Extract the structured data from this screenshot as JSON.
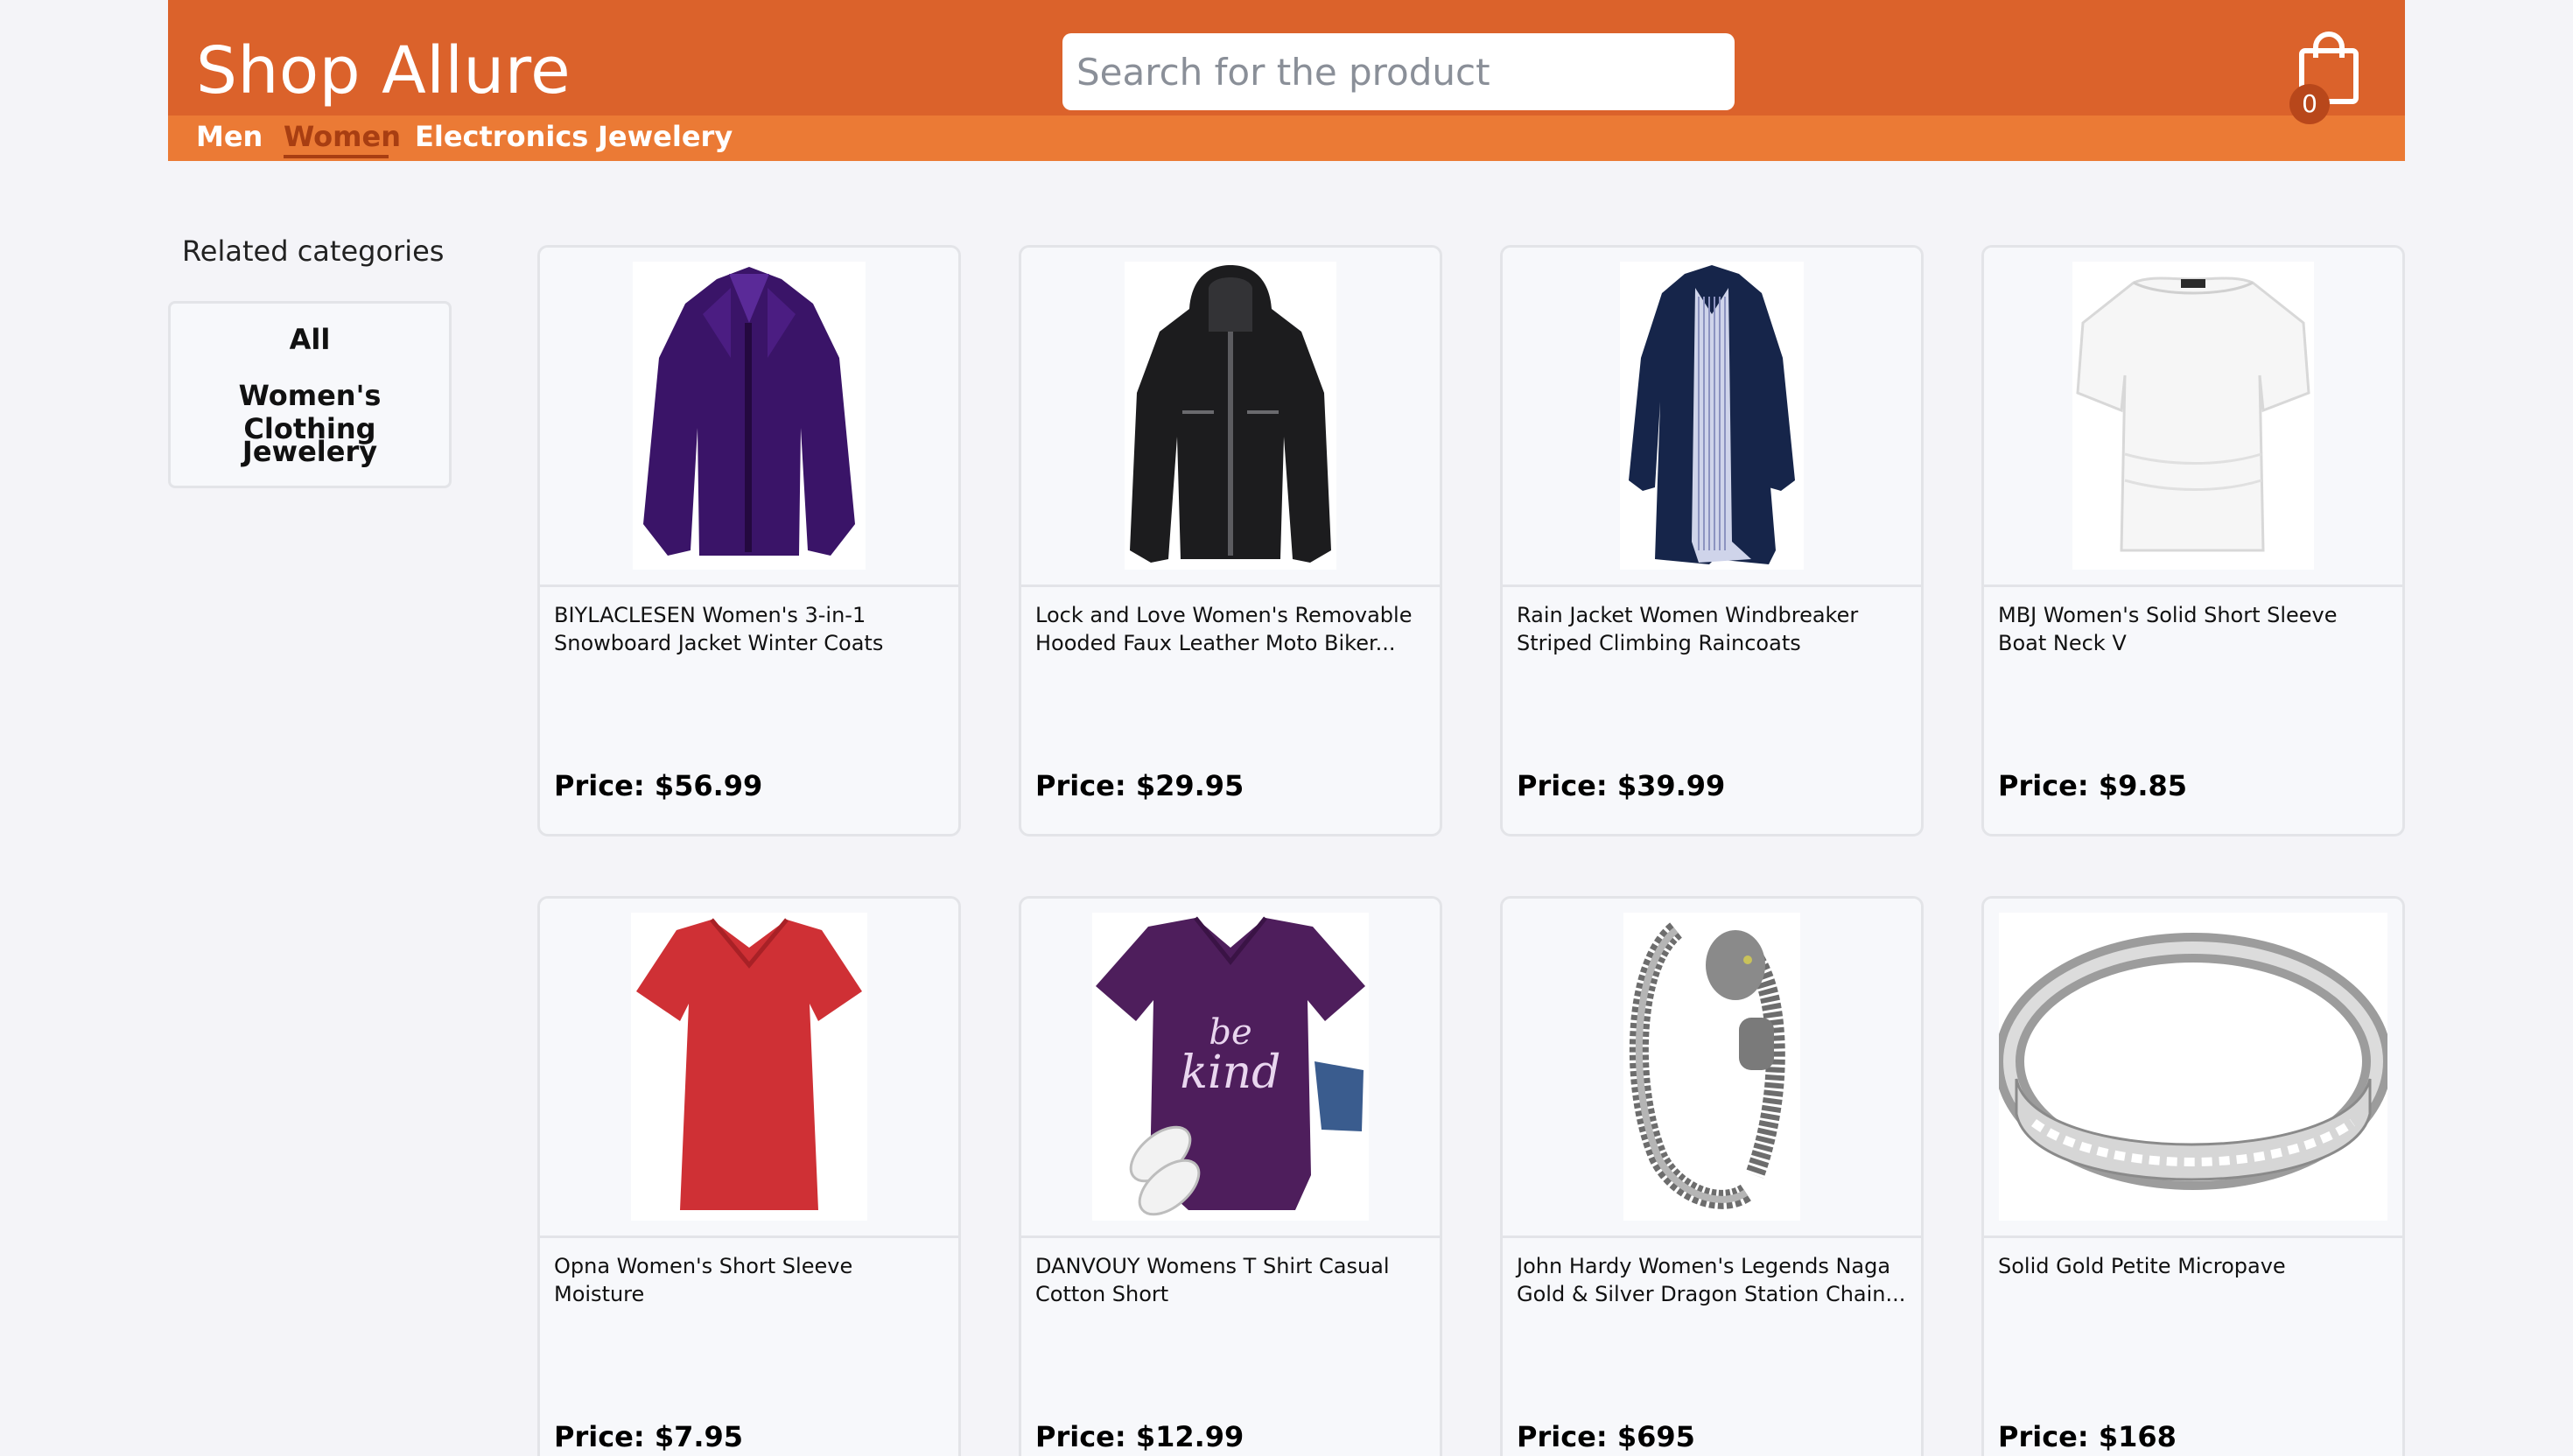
{
  "app": {
    "brand": "Shop Allure",
    "search_placeholder": "Search for the product",
    "cart_count": "0",
    "accent_color": "#db622b",
    "nav_color": "#eb7a35"
  },
  "nav": {
    "items": [
      {
        "label": "Men"
      },
      {
        "label": "Women",
        "active": true
      },
      {
        "label": "Electronics"
      },
      {
        "label": "Jewelery"
      }
    ]
  },
  "sidebar": {
    "title": "Related categories",
    "categories": [
      {
        "label": "All"
      },
      {
        "label": "Women's Clothing"
      },
      {
        "label": "Jewelery"
      }
    ]
  },
  "products": [
    {
      "title": "BIYLACLESEN Women's 3-in-1 Snowboard Jacket Winter Coats",
      "price": "Price: $56.99",
      "image": "purple-jacket"
    },
    {
      "title": "Lock and Love Women's Removable Hooded Faux Leather Moto Biker...",
      "price": "Price: $29.95",
      "image": "black-leather-jacket"
    },
    {
      "title": "Rain Jacket Women Windbreaker Striped Climbing Raincoats",
      "price": "Price: $39.99",
      "image": "navy-raincoat"
    },
    {
      "title": "MBJ Women's Solid Short Sleeve Boat Neck V",
      "price": "Price: $9.85",
      "image": "white-top"
    },
    {
      "title": "Opna Women's Short Sleeve Moisture",
      "price": "Price: $7.95",
      "image": "red-tshirt"
    },
    {
      "title": "DANVOUY Womens T Shirt Casual Cotton Short",
      "price": "Price: $12.99",
      "image": "purple-be-kind-tshirt"
    },
    {
      "title": "John Hardy Women's Legends Naga Gold & Silver Dragon Station Chain...",
      "price": "Price: $695",
      "image": "dragon-bracelet"
    },
    {
      "title": "Solid Gold Petite Micropave",
      "price": "Price: $168",
      "image": "silver-ring"
    }
  ]
}
